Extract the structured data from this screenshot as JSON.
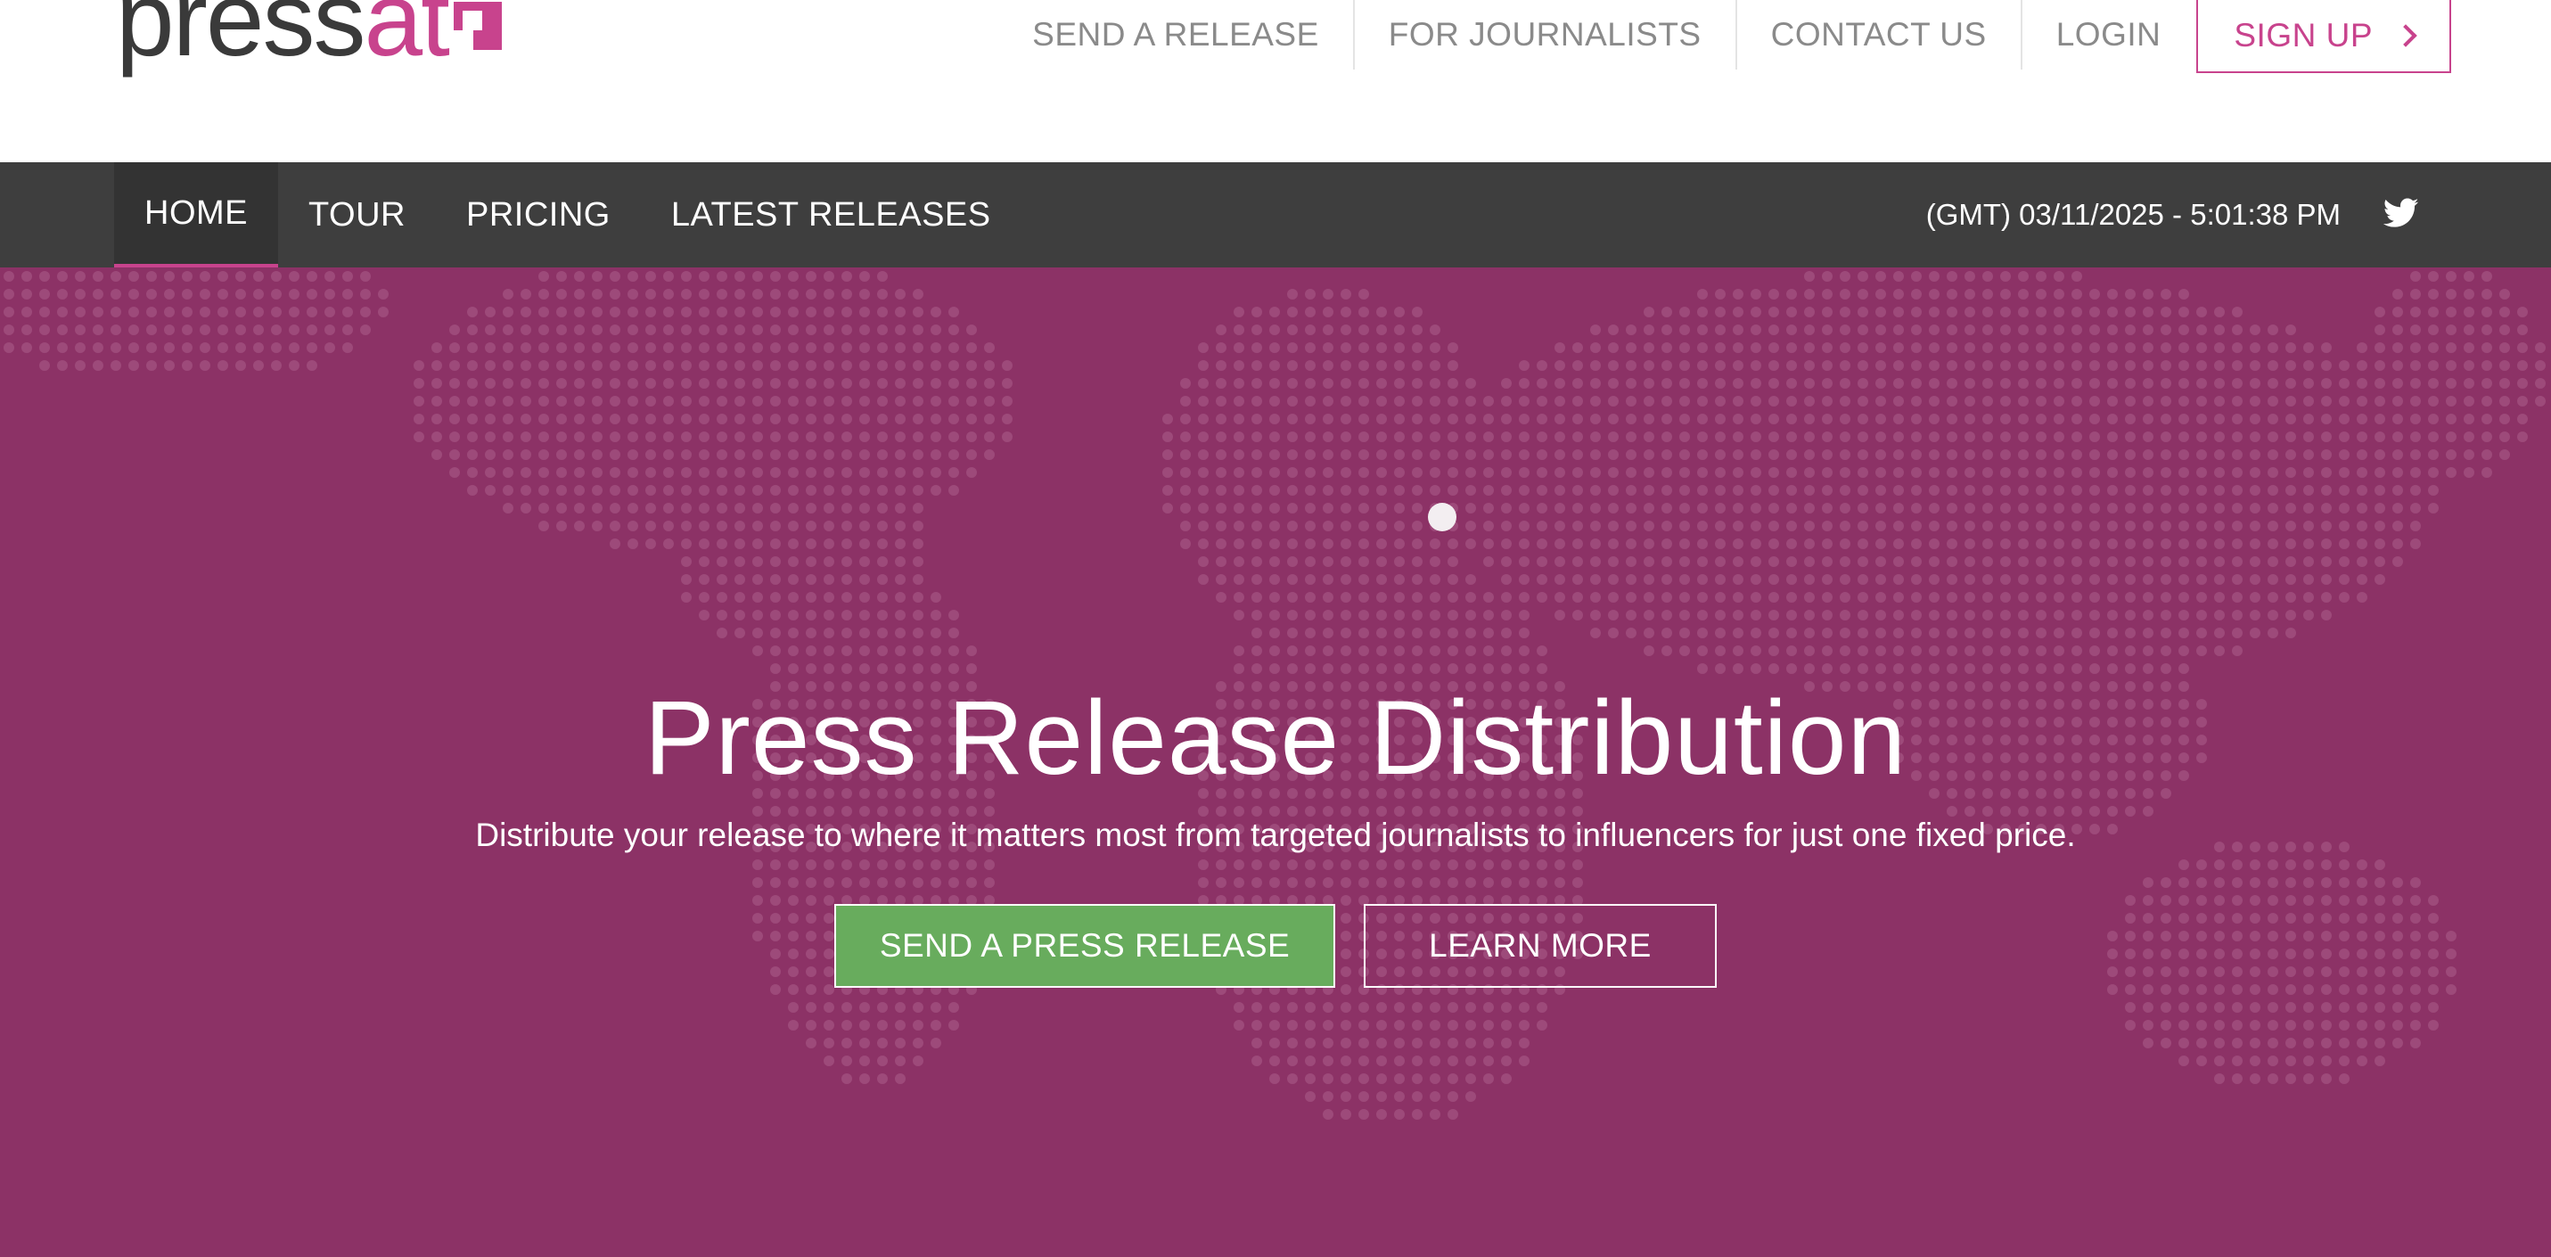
{
  "header": {
    "logo": {
      "word_main": "press",
      "word_accent": "at",
      "icon": "pressat-logo-mark-icon"
    },
    "top_nav": {
      "items": [
        {
          "label": "SEND A RELEASE"
        },
        {
          "label": "FOR JOURNALISTS"
        },
        {
          "label": "CONTACT US"
        },
        {
          "label": "LOGIN"
        }
      ],
      "signup_label": "SIGN UP",
      "signup_icon": "chevron-right-icon"
    }
  },
  "main_nav": {
    "items": [
      {
        "label": "HOME",
        "active": true
      },
      {
        "label": "TOUR",
        "active": false
      },
      {
        "label": "PRICING",
        "active": false
      },
      {
        "label": "LATEST RELEASES",
        "active": false
      }
    ],
    "clock_text": "(GMT) 03/11/2025 - 5:01:38 PM",
    "social_icon": "twitter-icon"
  },
  "hero": {
    "title": "Press Release Distribution",
    "subtitle": "Distribute your release to where it matters most from targeted journalists to influencers for just one fixed price.",
    "primary_button": "SEND A PRESS RELEASE",
    "secondary_button": "LEARN MORE",
    "background_icon": "world-map-dots-icon"
  },
  "colors": {
    "brand": "#c8438d",
    "hero_background": "#8c3266",
    "nav_background": "#3e3e3e",
    "primary_button": "#68ac5d",
    "top_nav_text": "#8a8a8a"
  }
}
